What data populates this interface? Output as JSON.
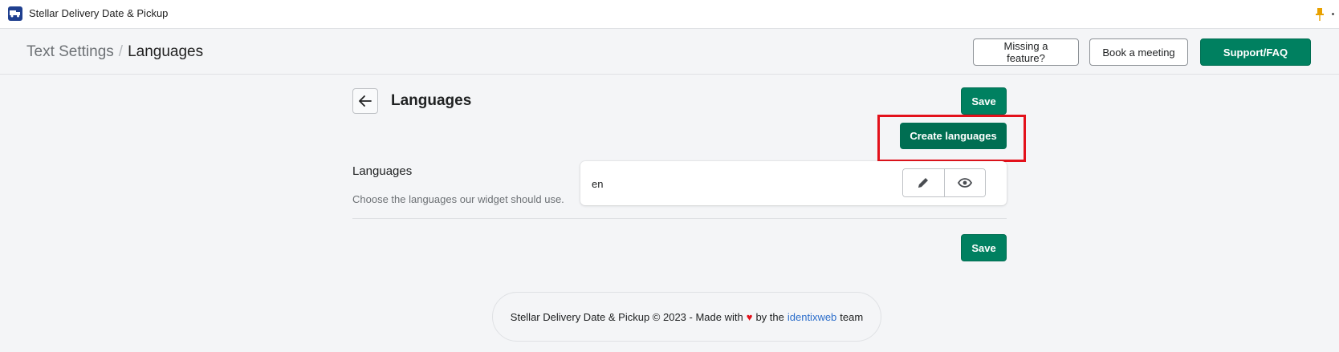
{
  "app": {
    "title": "Stellar Delivery Date & Pickup"
  },
  "header": {
    "breadcrumb_parent": "Text Settings",
    "breadcrumb_separator": "/",
    "breadcrumb_current": "Languages",
    "missing_feature_label": "Missing a feature?",
    "book_meeting_label": "Book a meeting",
    "support_label": "Support/FAQ"
  },
  "page": {
    "title": "Languages",
    "save_label": "Save",
    "create_languages_label": "Create languages",
    "section_title": "Languages",
    "section_description": "Choose the languages our widget should use.",
    "languages": [
      {
        "code": "en"
      }
    ]
  },
  "footer": {
    "text_before": "Stellar Delivery Date & Pickup © 2023 - Made with",
    "heart": "♥",
    "text_by": "by the",
    "link_text": "identixweb",
    "text_after": "team"
  },
  "colors": {
    "primary": "#008060",
    "highlight": "#e3111b",
    "link": "#2c6ecb"
  }
}
